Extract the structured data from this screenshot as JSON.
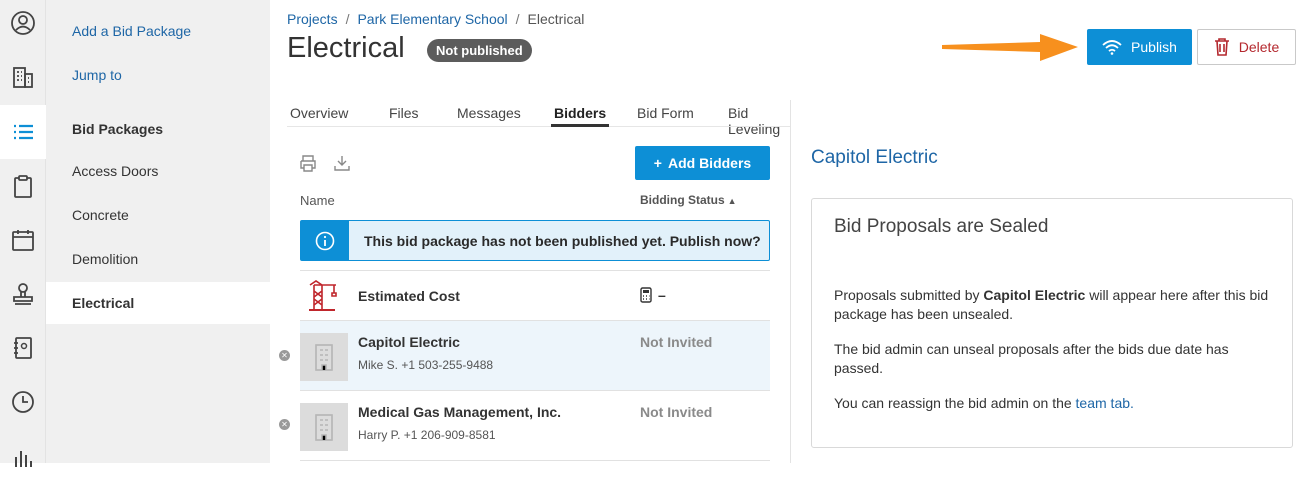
{
  "sidebar": {
    "add_link": "Add a Bid Package",
    "jump_link": "Jump to",
    "section_title": "Bid Packages",
    "items": [
      {
        "label": "Access Doors"
      },
      {
        "label": "Concrete"
      },
      {
        "label": "Demolition"
      },
      {
        "label": "Electrical"
      }
    ]
  },
  "breadcrumb": {
    "root": "Projects",
    "project": "Park Elementary School",
    "current": "Electrical",
    "separator": "/"
  },
  "header": {
    "title": "Electrical",
    "status_badge": "Not published",
    "publish_label": "Publish",
    "delete_label": "Delete"
  },
  "tabs": [
    {
      "label": "Overview"
    },
    {
      "label": "Files"
    },
    {
      "label": "Messages"
    },
    {
      "label": "Bidders"
    },
    {
      "label": "Bid Form"
    },
    {
      "label": "Bid Leveling"
    }
  ],
  "active_tab": "Bidders",
  "bidders": {
    "add_label": "Add Bidders",
    "add_icon": "+",
    "col_name": "Name",
    "col_status": "Bidding Status",
    "alert_text": "This bid package has not been published yet. Publish now?",
    "estimated_label": "Estimated Cost",
    "estimated_value": "–",
    "rows": [
      {
        "name": "Capitol Electric",
        "contact": "Mike S. +1 503-255-9488",
        "status": "Not Invited"
      },
      {
        "name": "Medical Gas Management, Inc.",
        "contact": "Harry P. +1 206-909-8581",
        "status": "Not Invited"
      }
    ]
  },
  "detail": {
    "title": "Capitol Electric",
    "card_title": "Bid Proposals are Sealed",
    "p1_pre": "Proposals submitted by ",
    "p1_bold": "Capitol Electric",
    "p1_post": " will appear here after this bid package has been unsealed.",
    "p2": "The bid admin can unseal proposals after the bids due date has passed.",
    "p3_pre": "You can reassign the bid admin on the ",
    "p3_link": "team tab."
  },
  "colors": {
    "accent": "#0d8fd6",
    "link": "#1e66a6",
    "delete": "#b4282e",
    "arrow": "#f7901e"
  }
}
